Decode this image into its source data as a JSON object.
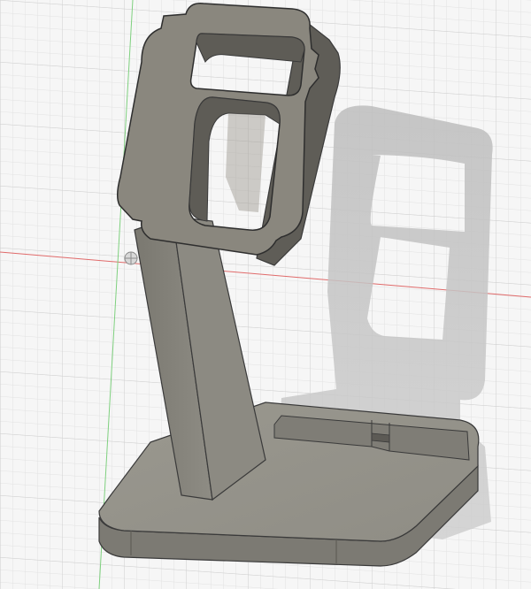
{
  "viewport": {
    "background": "#f6f6f6",
    "grid_minor": "#e2e2e2",
    "grid_major": "#cfcfcf",
    "axis_x_color": "#e06a6a",
    "axis_y_color": "#7fd07f"
  },
  "model": {
    "body_color": "#8f8d85",
    "face_color": "#8a877e",
    "edge_color": "#3a3a3a",
    "shadow_color": "#c4c4c4"
  }
}
